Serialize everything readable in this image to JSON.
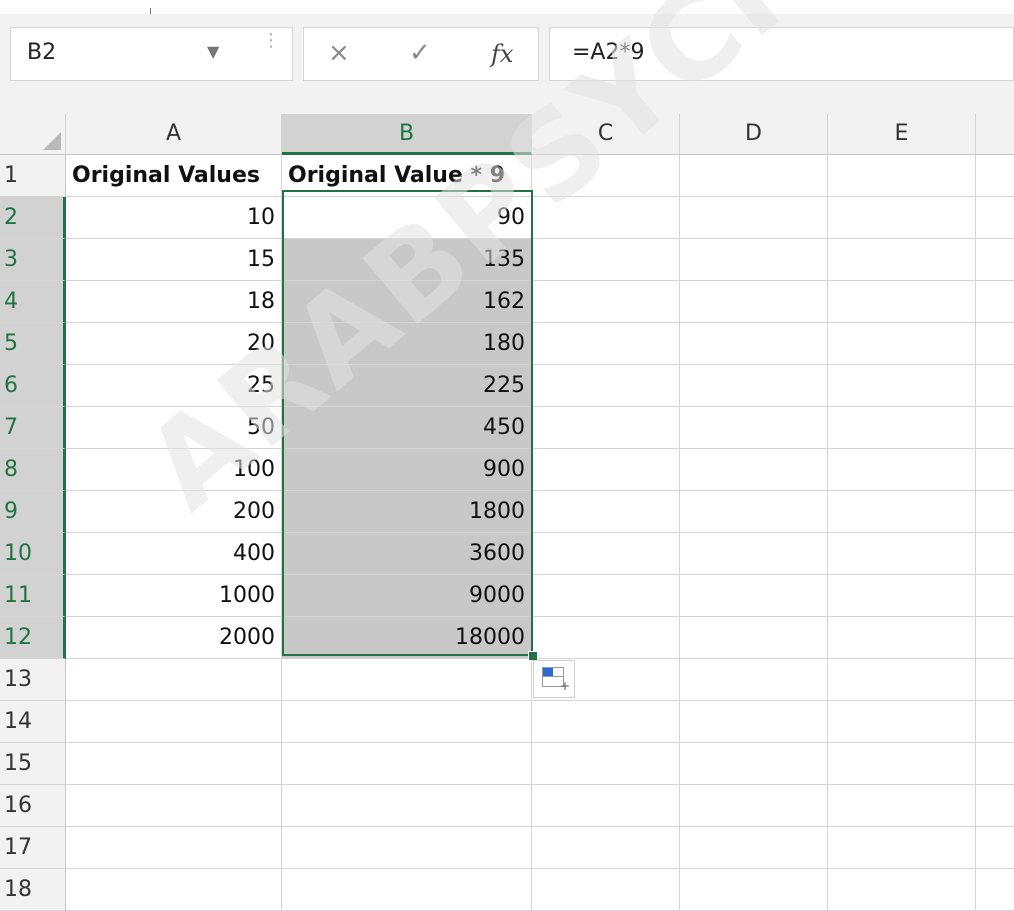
{
  "formula_bar": {
    "name_box": "B2",
    "cancel_symbol": "×",
    "enter_symbol": "✓",
    "fx_label": "fx",
    "formula": "=A2*9"
  },
  "columns": [
    "A",
    "B",
    "C",
    "D",
    "E"
  ],
  "selected_column": "B",
  "rows": [
    {
      "num": "1",
      "a": "Original Values",
      "b": "Original Value * 9"
    },
    {
      "num": "2",
      "a": "10",
      "b": "90"
    },
    {
      "num": "3",
      "a": "15",
      "b": "135"
    },
    {
      "num": "4",
      "a": "18",
      "b": "162"
    },
    {
      "num": "5",
      "a": "20",
      "b": "180"
    },
    {
      "num": "6",
      "a": "25",
      "b": "225"
    },
    {
      "num": "7",
      "a": "50",
      "b": "450"
    },
    {
      "num": "8",
      "a": "100",
      "b": "900"
    },
    {
      "num": "9",
      "a": "200",
      "b": "1800"
    },
    {
      "num": "10",
      "a": "400",
      "b": "3600"
    },
    {
      "num": "11",
      "a": "1000",
      "b": "9000"
    },
    {
      "num": "12",
      "a": "2000",
      "b": "18000"
    },
    {
      "num": "13",
      "a": "",
      "b": ""
    },
    {
      "num": "14",
      "a": "",
      "b": ""
    },
    {
      "num": "15",
      "a": "",
      "b": ""
    },
    {
      "num": "16",
      "a": "",
      "b": ""
    },
    {
      "num": "17",
      "a": "",
      "b": ""
    },
    {
      "num": "18",
      "a": "",
      "b": ""
    }
  ],
  "selected_range": "B2:B12",
  "active_cell": "B2",
  "watermark": "ARABPSYCHOLOGY.C",
  "colors": {
    "accent": "#217346",
    "selection": "#c8c8c8",
    "header_bg": "#f2f2f2"
  },
  "icons": {
    "quick_analysis": "quick-analysis-icon"
  }
}
